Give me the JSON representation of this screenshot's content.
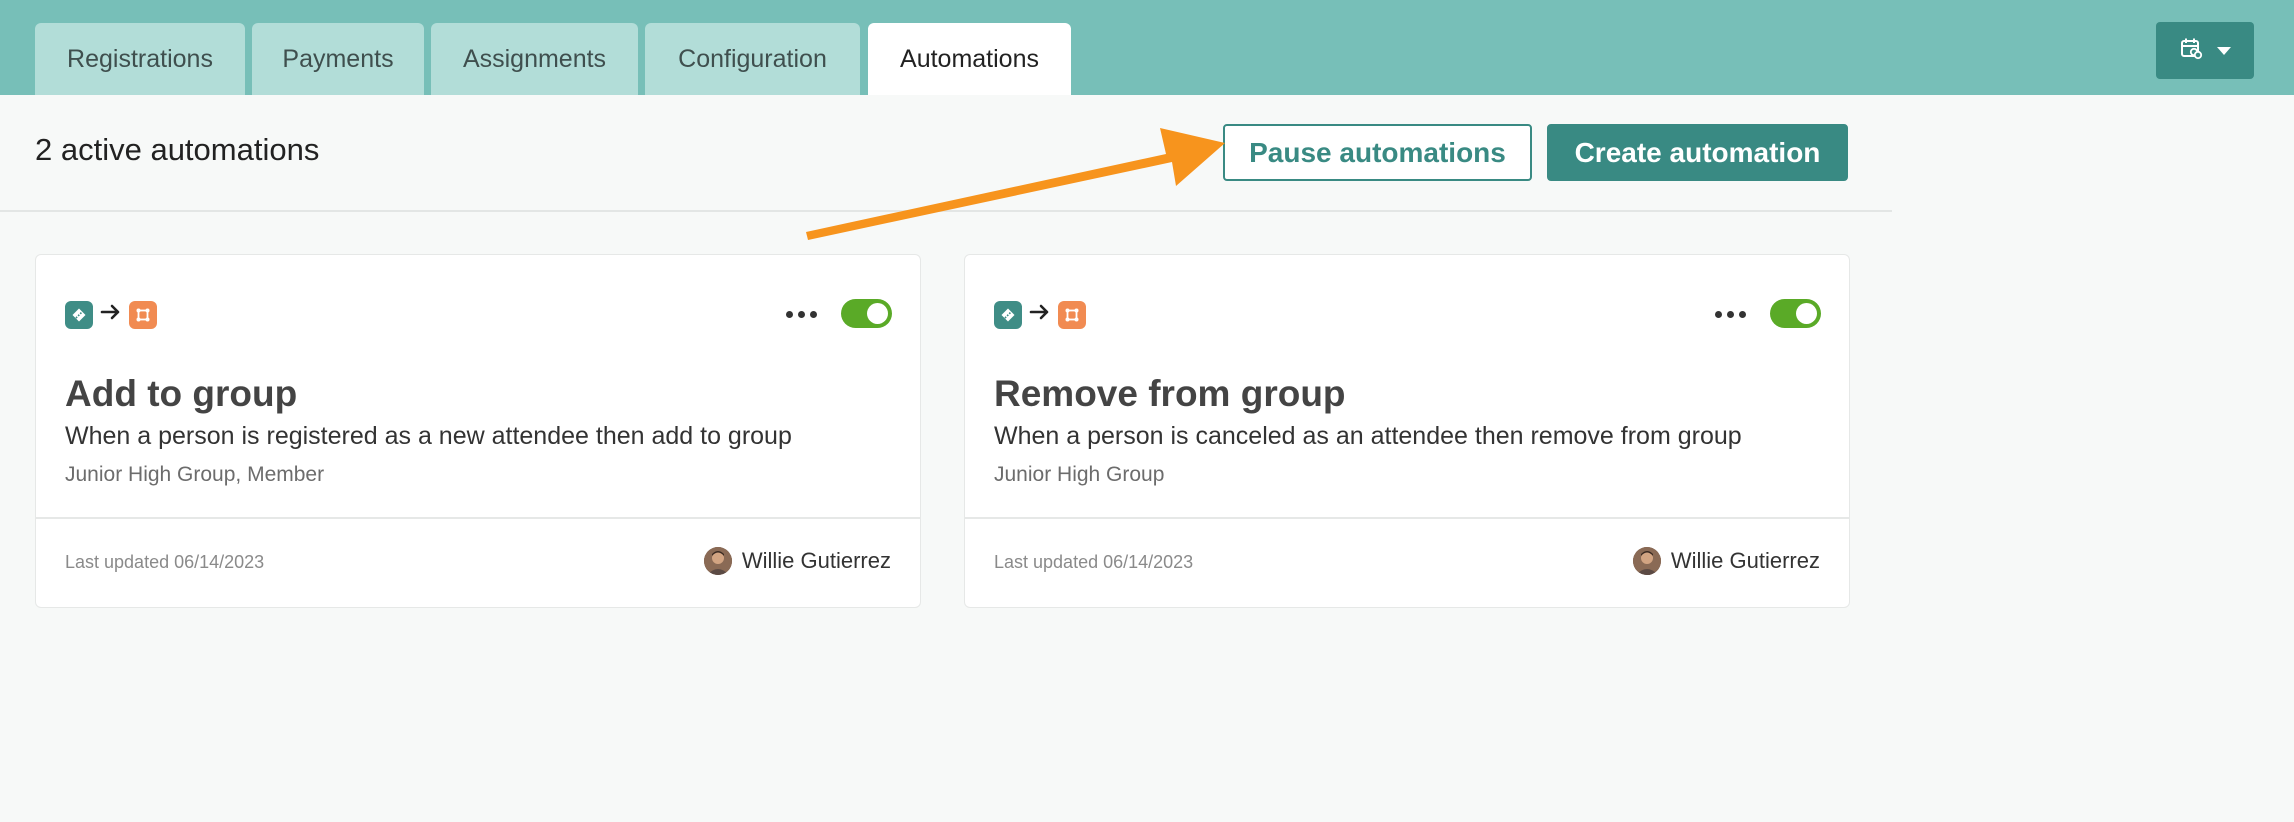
{
  "tabs": [
    {
      "label": "Registrations",
      "active": false
    },
    {
      "label": "Payments",
      "active": false
    },
    {
      "label": "Assignments",
      "active": false
    },
    {
      "label": "Configuration",
      "active": false
    },
    {
      "label": "Automations",
      "active": true
    }
  ],
  "toolbar": {
    "calendar_button_icon": "calendar-link-icon",
    "active_count_text": "2 active automations",
    "pause_label": "Pause automations",
    "create_label": "Create automation"
  },
  "annotation": {
    "arrow_color": "#f7941d",
    "points_to": "Pause automations"
  },
  "automations": [
    {
      "title": "Add to group",
      "description": "When a person is registered as a new attendee then add to group",
      "detail": "Junior High Group, Member",
      "updated": "Last updated 06/14/2023",
      "user": "Willie Gutierrez",
      "enabled": true,
      "trigger_icon": "ticket-icon",
      "action_icon": "group-icon"
    },
    {
      "title": "Remove from group",
      "description": "When a person is canceled as an attendee then remove from group",
      "detail": "Junior High Group",
      "updated": "Last updated 06/14/2023",
      "user": "Willie Gutierrez",
      "enabled": true,
      "trigger_icon": "ticket-icon",
      "action_icon": "group-icon"
    }
  ],
  "colors": {
    "topbar": "#77bfb8",
    "tab_inactive": "#b2ddd8",
    "primary": "#398a83",
    "toggle_on": "#5aaa27",
    "trigger_icon_bg": "#3f8d86",
    "action_icon_bg": "#f18b52"
  }
}
